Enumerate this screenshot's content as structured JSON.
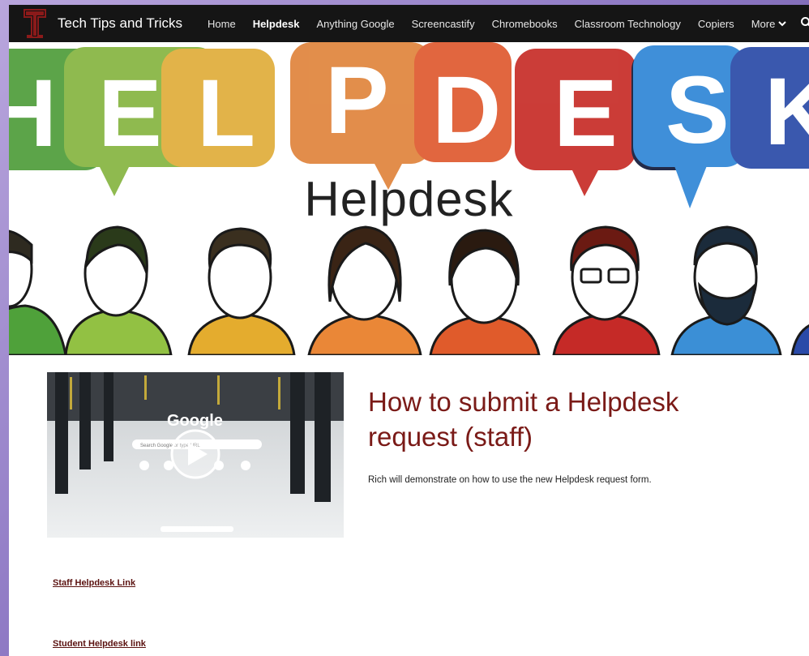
{
  "site": {
    "title": "Tech Tips and Tricks",
    "logo_letter": "T"
  },
  "nav": {
    "items": [
      {
        "label": "Home",
        "active": false
      },
      {
        "label": "Helpdesk",
        "active": true
      },
      {
        "label": "Anything Google",
        "active": false
      },
      {
        "label": "Screencastify",
        "active": false
      },
      {
        "label": "Chromebooks",
        "active": false
      },
      {
        "label": "Classroom Technology",
        "active": false
      },
      {
        "label": "Copiers",
        "active": false
      }
    ],
    "more_label": "More"
  },
  "hero": {
    "title": "Helpdesk",
    "banner_letters": [
      "H",
      "E",
      "L",
      "P",
      "D",
      "E",
      "S",
      "K"
    ]
  },
  "video": {
    "brand": "Google",
    "search_placeholder": "Search Google or type URL"
  },
  "section": {
    "heading": "How to submit a Helpdesk request (staff)",
    "description": "Rich will demonstrate on how to use the new Helpdesk request form."
  },
  "links": {
    "staff": "Staff Helpdesk Link",
    "student": "Student Helpdesk link"
  },
  "colors": {
    "nav_bg": "#151515",
    "heading": "#7a1a17",
    "link": "#5b1210",
    "logo": "#8b1a1a"
  }
}
